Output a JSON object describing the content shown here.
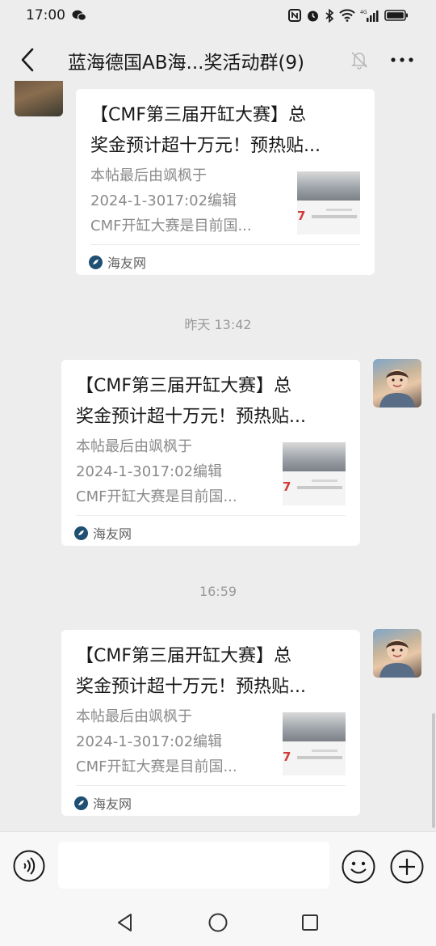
{
  "status_bar": {
    "time": "17:00",
    "network_label": "4G",
    "icons": [
      "wechat-icon",
      "nfc-icon",
      "alarm-icon",
      "bluetooth-icon",
      "wifi-icon",
      "signal-icon",
      "battery-icon"
    ]
  },
  "header": {
    "title": "蓝海德国AB海...奖活动群(9)",
    "icons": [
      "back-arrow-icon",
      "mute-bell-icon",
      "more-dots-icon"
    ]
  },
  "messages": [
    {
      "sender": "other",
      "title_line1": "【CMF第三届开缸大赛】总",
      "title_line2": "奖金预计超十万元！预热贴...",
      "desc_line1": "本帖最后由飒枫于",
      "desc_line2": "2024-1-3017:02编辑",
      "desc_line3": "CMF开缸大赛是目前国...",
      "source": "海友网"
    },
    {
      "timestamp": "昨天 13:42",
      "sender": "self",
      "title_line1": "【CMF第三届开缸大赛】总",
      "title_line2": "奖金预计超十万元！预热贴...",
      "desc_line1": "本帖最后由飒枫于",
      "desc_line2": "2024-1-3017:02编辑",
      "desc_line3": "CMF开缸大赛是目前国...",
      "source": "海友网"
    },
    {
      "timestamp": "16:59",
      "sender": "self",
      "title_line1": "【CMF第三届开缸大赛】总",
      "title_line2": "奖金预计超十万元！预热贴...",
      "desc_line1": "本帖最后由飒枫于",
      "desc_line2": "2024-1-3017:02编辑",
      "desc_line3": "CMF开缸大赛是目前国...",
      "source": "海友网"
    }
  ],
  "thumbnail": {
    "numeral": "7"
  },
  "input_bar": {
    "placeholder": "",
    "icons": [
      "voice-icon",
      "emoji-icon",
      "plus-icon"
    ]
  },
  "nav_bar": {
    "icons": [
      "nav-back-icon",
      "nav-home-icon",
      "nav-recent-icon"
    ]
  },
  "colors": {
    "background": "#ededed",
    "bubble": "#ffffff",
    "source_icon": "#1f4f73",
    "thumb_numeral": "#d03a3a"
  }
}
